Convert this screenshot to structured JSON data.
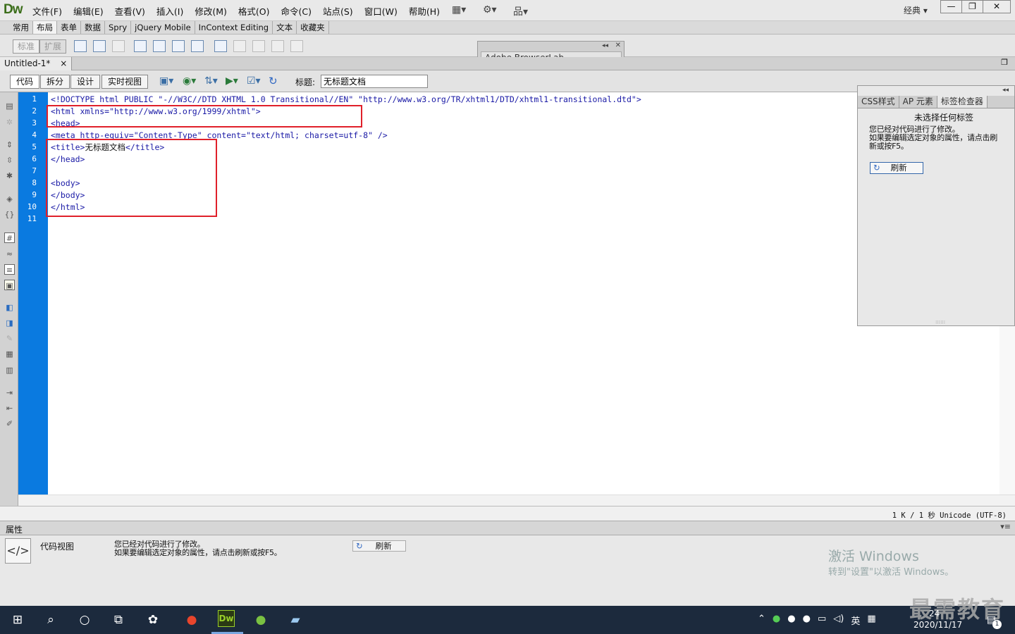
{
  "app": {
    "logo": "Dw"
  },
  "menu": [
    "文件(F)",
    "编辑(E)",
    "查看(V)",
    "插入(I)",
    "修改(M)",
    "格式(O)",
    "命令(C)",
    "站点(S)",
    "窗口(W)",
    "帮助(H)"
  ],
  "workspace": "经典",
  "insert_tabs": [
    "常用",
    "布局",
    "表单",
    "数据",
    "Spry",
    "jQuery Mobile",
    "InContext Editing",
    "文本",
    "收藏夹"
  ],
  "insert_tab_selected": "布局",
  "layout_modes": {
    "standard": "标准",
    "expanded": "扩展"
  },
  "browserlab": {
    "title": "Adobe BrowserLab"
  },
  "document": {
    "tab": "Untitled-1*",
    "close": "×"
  },
  "view_buttons": {
    "code": "代码",
    "split": "拆分",
    "design": "设计",
    "live": "实时视图"
  },
  "title_label": "标题:",
  "title_value": "无标题文档",
  "line_numbers": [
    "1",
    "2",
    "3",
    "4",
    "5",
    "6",
    "7",
    "8",
    "9",
    "10",
    "11"
  ],
  "code": {
    "l1": "<!DOCTYPE html PUBLIC \"-//W3C//DTD XHTML 1.0 Transitional//EN\" \"http://www.w3.org/TR/xhtml1/DTD/xhtml1-transitional.dtd\">",
    "l2": "<html xmlns=\"http://www.w3.org/1999/xhtml\">",
    "l3": "<head>",
    "l4": "<meta http-equiv=\"Content-Type\" content=\"text/html; charset=utf-8\" />",
    "l5a": "<title>",
    "l5b": "无标题文档",
    "l5c": "</title>",
    "l6": "</head>",
    "l7": "",
    "l8": "<body>",
    "l9": "</body>",
    "l10": "</html>",
    "l11": ""
  },
  "status": "1 K / 1 秒  Unicode (UTF-8)",
  "right_panel": {
    "tabs": [
      "CSS样式",
      "AP 元素",
      "标签检查器"
    ],
    "no_selection": "未选择任何标签",
    "msg1": "您已经对代码进行了修改。",
    "msg2": "如果要编辑选定对象的属性，请点击刷",
    "msg3": "新或按F5。",
    "refresh": "刷新"
  },
  "properties": {
    "label": "属性",
    "view": "代码视图",
    "msg1": "您已经对代码进行了修改。",
    "msg2": "如果要编辑选定对象的属性，请点击刷新或按F5。",
    "refresh": "刷新"
  },
  "watermark": {
    "line1": "激活 Windows",
    "line2": "转到\"设置\"以激活 Windows。"
  },
  "taskbar": {
    "ime": "英",
    "time": "24",
    "date": "2020/11/17",
    "notify": "1"
  },
  "brand": "最需教育",
  "colors": {
    "gutter": "#0a7ae0",
    "highlight": "#e0202a",
    "code": "#1a1aa6"
  }
}
